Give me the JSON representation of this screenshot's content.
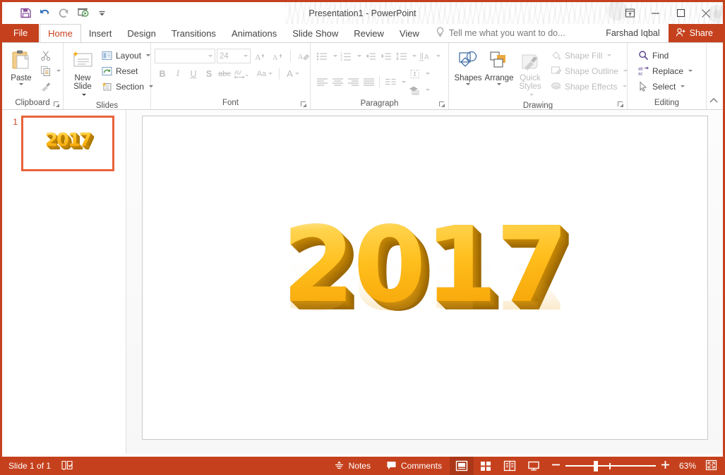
{
  "window": {
    "title": "Presentation1 - PowerPoint",
    "quick_access": [
      {
        "name": "save",
        "label": "Save"
      },
      {
        "name": "undo",
        "label": "Undo"
      },
      {
        "name": "redo",
        "label": "Redo"
      },
      {
        "name": "start-from-beginning",
        "label": "Start From Beginning"
      },
      {
        "name": "customize-qat",
        "label": "Customize Quick Access Toolbar"
      }
    ],
    "controls": [
      {
        "name": "ribbon-display-options",
        "label": "Ribbon Display Options"
      },
      {
        "name": "minimize",
        "label": "Minimize"
      },
      {
        "name": "maximize",
        "label": "Restore Down"
      },
      {
        "name": "close",
        "label": "Close"
      }
    ]
  },
  "tabs": {
    "file": "File",
    "items": [
      "Home",
      "Insert",
      "Design",
      "Transitions",
      "Animations",
      "Slide Show",
      "Review",
      "View"
    ],
    "active": "Home",
    "tell_me": "Tell me what you want to do...",
    "user": "Farshad Iqbal",
    "share": "Share"
  },
  "ribbon": {
    "groups": [
      {
        "name": "clipboard",
        "label": "Clipboard",
        "paste": "Paste",
        "items": [
          "Cut",
          "Copy",
          "Format Painter"
        ],
        "has_launcher": true
      },
      {
        "name": "slides",
        "label": "Slides",
        "new_slide": "New Slide",
        "items": [
          "Layout",
          "Reset",
          "Section"
        ],
        "has_launcher": false
      },
      {
        "name": "font",
        "label": "Font",
        "font_name": "",
        "font_name_placeholder": "",
        "font_size": "24",
        "buttons": [
          "Increase Font Size",
          "Decrease Font Size",
          "Clear All Formatting",
          "Bold",
          "Italic",
          "Underline",
          "Text Shadow",
          "Strikethrough",
          "Character Spacing",
          "Change Case",
          "Font Color"
        ],
        "has_launcher": true,
        "disabled": true
      },
      {
        "name": "paragraph",
        "label": "Paragraph",
        "buttons": [
          "Bullets",
          "Numbering",
          "Decrease List Level",
          "Increase List Level",
          "Line Spacing",
          "Text Direction",
          "Align Text",
          "Convert to SmartArt",
          "Align Left",
          "Center",
          "Align Right",
          "Justify",
          "Columns"
        ],
        "has_launcher": true,
        "disabled": true
      },
      {
        "name": "drawing",
        "label": "Drawing",
        "shapes": "Shapes",
        "arrange": "Arrange",
        "quick_styles": "Quick Styles",
        "items": [
          "Shape Fill",
          "Shape Outline",
          "Shape Effects"
        ],
        "has_launcher": true
      },
      {
        "name": "editing",
        "label": "Editing",
        "items": [
          "Find",
          "Replace",
          "Select"
        ],
        "has_launcher": false
      }
    ],
    "collapse_label": "Collapse the Ribbon"
  },
  "thumbnails": {
    "slides": [
      {
        "number": "1",
        "art_text": "2017",
        "selected": true
      }
    ]
  },
  "slide": {
    "art_text": "2017"
  },
  "status": {
    "slide_count": "Slide 1 of 1",
    "accessibility_label": "Spell check / Accessibility",
    "notes": "Notes",
    "comments": "Comments",
    "views": [
      {
        "name": "normal",
        "label": "Normal",
        "active": true
      },
      {
        "name": "slide-sorter",
        "label": "Slide Sorter",
        "active": false
      },
      {
        "name": "reading-view",
        "label": "Reading View",
        "active": false
      },
      {
        "name": "slide-show",
        "label": "Slide Show",
        "active": false
      }
    ],
    "zoom_out": "Zoom Out",
    "zoom_in": "Zoom In",
    "zoom_level": "63%",
    "fit_label": "Fit slide to current window"
  },
  "colors": {
    "accent": "#c5411d",
    "accent_dark": "#aa3717",
    "thumb_border": "#e8633b",
    "gold_light": "#ffd34d",
    "gold": "#fcb514",
    "gold_dark": "#996603"
  }
}
